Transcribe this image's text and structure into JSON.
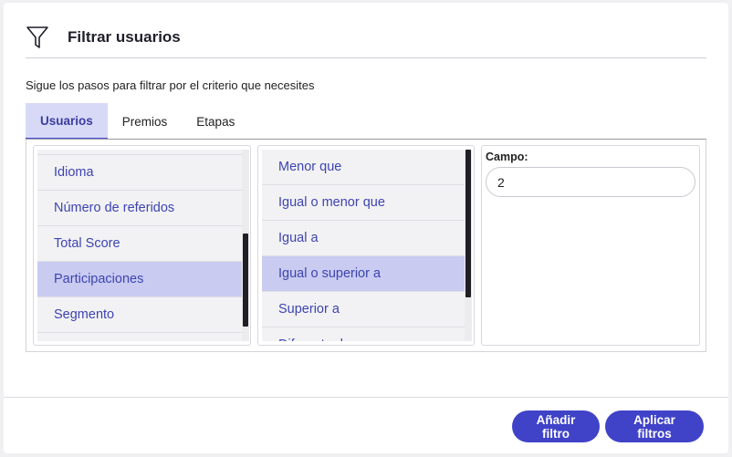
{
  "header": {
    "title": "Filtrar usuarios",
    "icon": "funnel-icon"
  },
  "description": "Sigue los pasos para filtrar por el criterio que necesites",
  "tabs": [
    {
      "label": "Usuarios",
      "active": true
    },
    {
      "label": "Premios",
      "active": false
    },
    {
      "label": "Etapas",
      "active": false
    }
  ],
  "fields_list": {
    "items": [
      {
        "label": "Idioma"
      },
      {
        "label": "Número de referidos"
      },
      {
        "label": "Total Score"
      },
      {
        "label": "Participaciones",
        "selected": true
      },
      {
        "label": "Segmento"
      }
    ]
  },
  "operators_list": {
    "items": [
      {
        "label": "Menor que"
      },
      {
        "label": "Igual o menor que"
      },
      {
        "label": "Igual a"
      },
      {
        "label": "Igual o superior a",
        "selected": true
      },
      {
        "label": "Superior a"
      },
      {
        "label": "Diferente de"
      }
    ]
  },
  "value_field": {
    "label": "Campo:",
    "value": "2"
  },
  "footer": {
    "add_label": "Añadir filtro",
    "apply_label": "Aplicar filtros"
  },
  "colors": {
    "accent": "#4042c8",
    "selected_bg": "#c9cbf1",
    "link_text": "#3d44b0"
  }
}
